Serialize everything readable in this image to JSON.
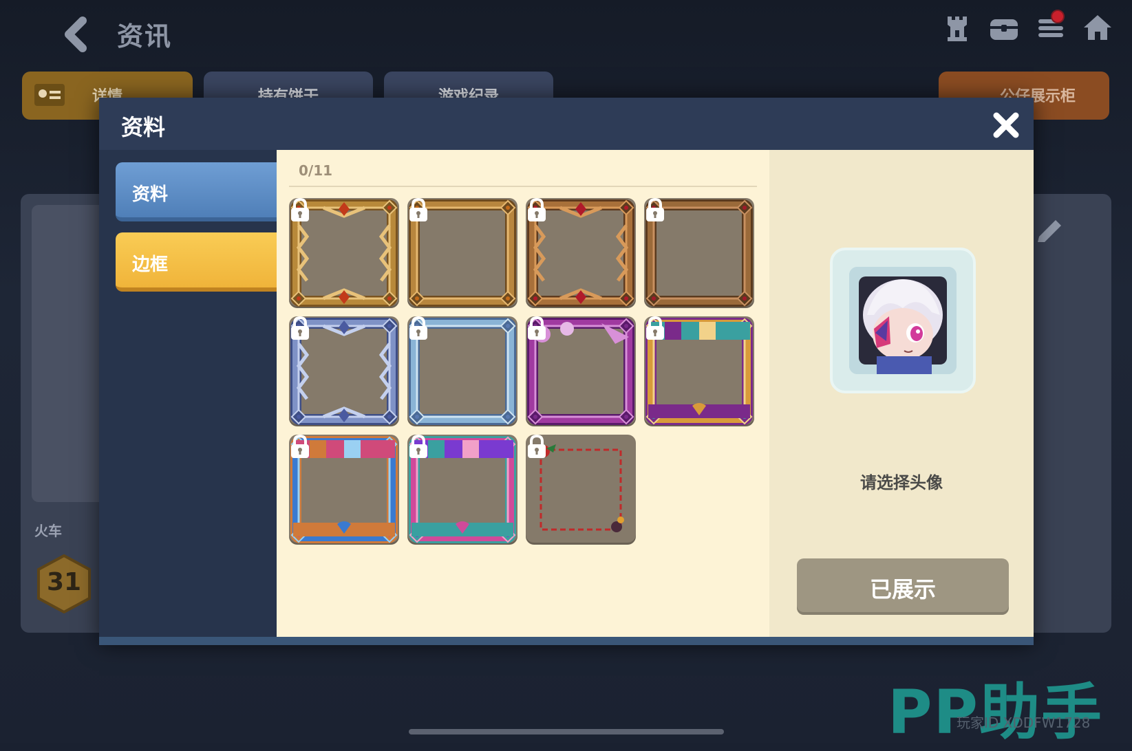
{
  "header": {
    "title": "资讯",
    "icons": [
      "back-icon",
      "castle-icon",
      "chest-icon",
      "menu-icon",
      "home-icon"
    ]
  },
  "background_tabs": [
    {
      "label": "详情"
    },
    {
      "label": "持有饼干"
    },
    {
      "label": "游戏纪录"
    },
    {
      "label": "公仔展示柜"
    }
  ],
  "background_card": {
    "train_label": "火车",
    "level": "31"
  },
  "modal": {
    "title": "资料",
    "sidebar": [
      {
        "label": "资料",
        "state": "normal"
      },
      {
        "label": "边框",
        "state": "selected"
      }
    ],
    "frames_count": "0/11",
    "frames": [
      {
        "style": "gold-ornate",
        "locked": true
      },
      {
        "style": "gold-simple",
        "locked": true
      },
      {
        "style": "ruby-ornate",
        "locked": true
      },
      {
        "style": "ruby-simple",
        "locked": true
      },
      {
        "style": "silver-ornate",
        "locked": true
      },
      {
        "style": "silver-simple",
        "locked": true
      },
      {
        "style": "purple-candy",
        "locked": true
      },
      {
        "style": "orange-festive",
        "locked": true
      },
      {
        "style": "blue-festive",
        "locked": true
      },
      {
        "style": "pink-festive",
        "locked": true
      },
      {
        "style": "christmas-dashed",
        "locked": true
      }
    ],
    "preview_hint": "请选择头像",
    "show_button": "已展示"
  },
  "watermark": {
    "brand": "PP助手",
    "sub": "玩家ID XDDFW1728"
  },
  "colors": {
    "sidebar_active": "#f0b43a",
    "sidebar_normal": "#5b8ac2",
    "panel_bg": "#fdf3d6",
    "cell_bg": "#857a6a"
  }
}
